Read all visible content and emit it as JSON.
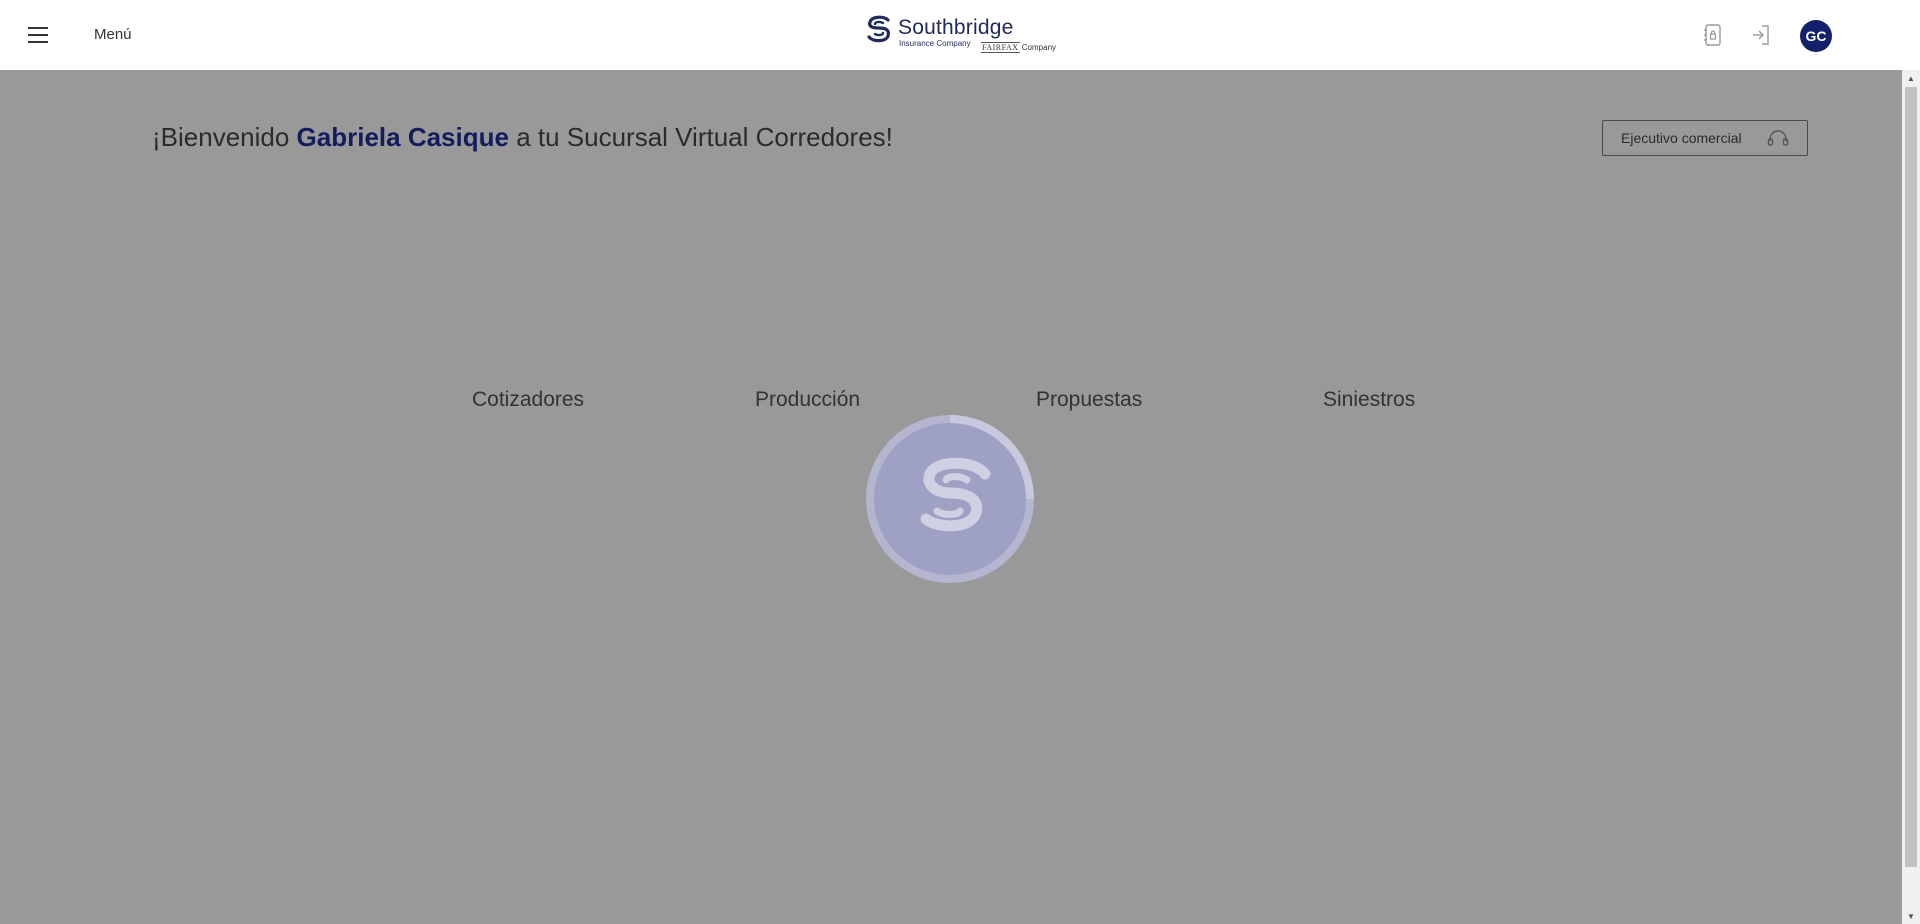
{
  "header": {
    "menu_label": "Menú",
    "logo": {
      "name": "Southbridge",
      "subtitle": "Insurance Company",
      "fairfax": "FAIRFAX",
      "fairfax_suffix": "Company"
    },
    "icons": [
      "contacts-lock-icon",
      "login-icon"
    ],
    "avatar_initials": "GC"
  },
  "main": {
    "welcome_prefix": "¡Bienvenido",
    "user_name": "Gabriela Casique",
    "welcome_suffix": "a tu Sucursal Virtual Corredores!",
    "executive_button": "Ejecutivo comercial",
    "tabs": [
      {
        "label": "Cotizadores"
      },
      {
        "label": "Producción"
      },
      {
        "label": "Propuestas"
      },
      {
        "label": "Siniestros"
      }
    ]
  },
  "colors": {
    "brand": "#13206b",
    "overlay": "#999999",
    "loader_fill": "#9ea0c4"
  }
}
